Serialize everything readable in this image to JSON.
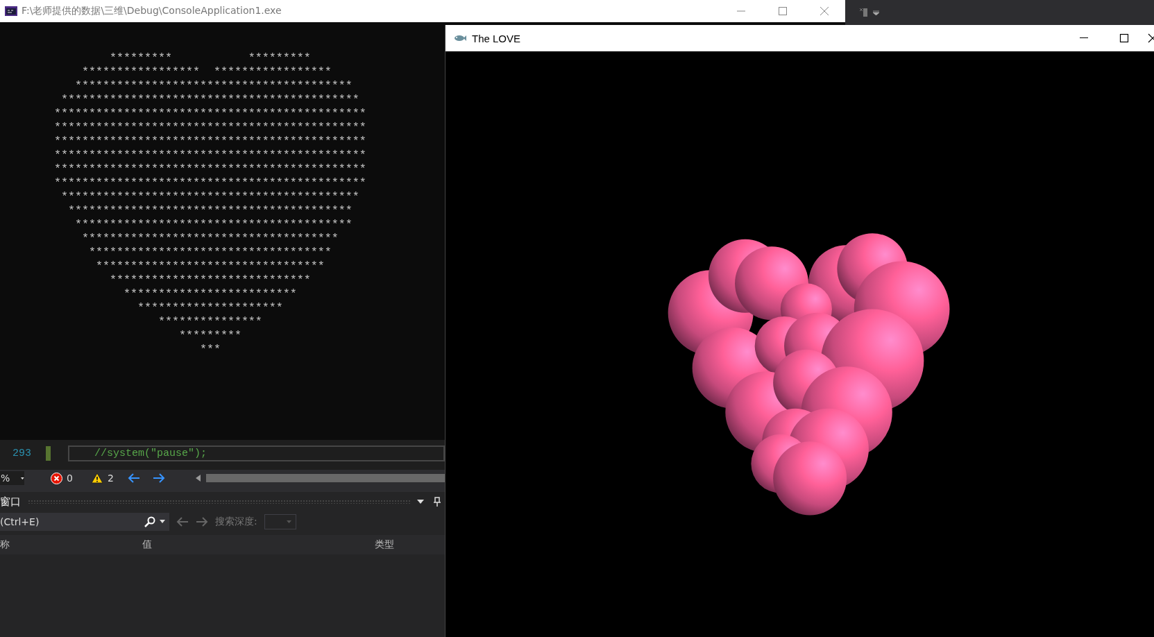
{
  "console_window": {
    "title": "F:\\老师提供的数据\\三维\\Debug\\ConsoleApplication1.exe",
    "output": "        *********           *********\n    *****************  *****************\n   ****************************************\n *******************************************\n*********************************************\n*********************************************\n*********************************************\n*********************************************\n*********************************************\n*********************************************\n *******************************************\n  *****************************************\n   ****************************************\n    *************************************\n     ***********************************\n      *********************************\n        *****************************\n          *************************\n            *********************\n               ***************\n                  *********\n                     ***"
  },
  "editor": {
    "lines": [
      {
        "number": "293",
        "code": "//system(\"pause\");",
        "kind": "comment",
        "current": true
      }
    ]
  },
  "status_bar": {
    "zoom": "%",
    "errors": "0",
    "warnings": "2"
  },
  "locals_panel": {
    "title": "窗口",
    "search_placeholder": "(Ctrl+E)",
    "depth_label": "搜索深度:",
    "columns": [
      "称",
      "值",
      "类型"
    ]
  },
  "render_window": {
    "title": "The LOVE"
  }
}
